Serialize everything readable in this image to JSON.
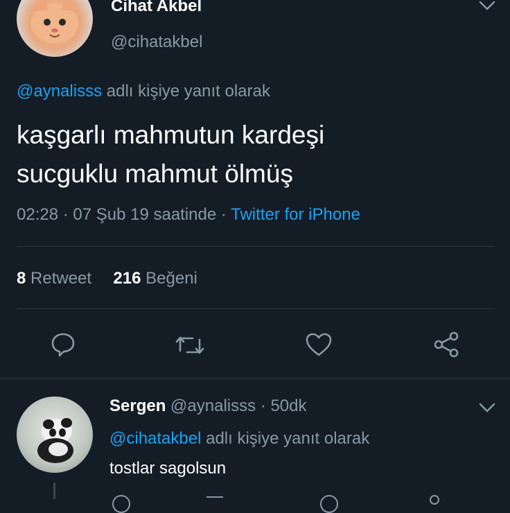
{
  "tweet": {
    "author_name": "Cihat Akbel",
    "author_handle": "@cihatakbel",
    "reply_to_handle": "@aynalisss",
    "reply_to_suffix": "adlı kişiye yanıt olarak",
    "text_line1": "kaşgarlı mahmutun kardeşi",
    "text_line2": "sucguklu mahmut ölmüş",
    "time": "02:28",
    "date": "07 Şub 19 saatinde",
    "client": "Twitter for iPhone",
    "retweet_count": "8",
    "retweet_label": "Retweet",
    "like_count": "216",
    "like_label": "Beğeni"
  },
  "reply": {
    "author_name": "Sergen",
    "author_handle": "@aynalisss",
    "age": "50dk",
    "reply_to_handle": "@cihatakbel",
    "reply_to_suffix": "adlı kişiye yanıt olarak",
    "text": "tostlar sagolsun"
  },
  "colors": {
    "background": "#141d26",
    "link": "#1da1f2",
    "muted": "#8899a6",
    "divider": "#2b3a48"
  },
  "icons": [
    "chevron-down-icon",
    "reply-icon",
    "retweet-icon",
    "like-icon",
    "share-icon"
  ]
}
